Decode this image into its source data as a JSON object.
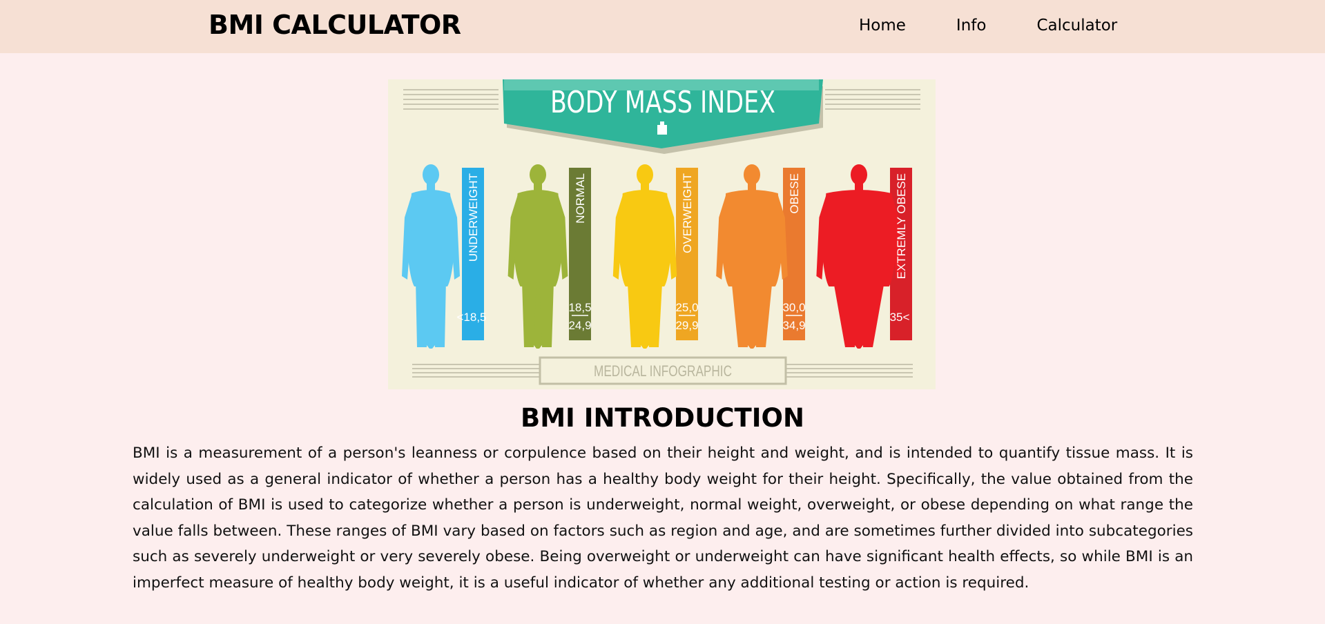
{
  "header": {
    "brand": "BMI CALCULATOR",
    "nav": [
      "Home",
      "Info",
      "Calculator"
    ]
  },
  "infographic": {
    "title": "BODY MASS INDEX",
    "footer": "MEDICAL INFOGRAPHIC",
    "categories": [
      {
        "label": "UNDERWEIGHT",
        "range_top": "<18,5",
        "range_bottom": "",
        "bar_color": "#2aaee6",
        "figure_color": "#5cc9f2"
      },
      {
        "label": "NORMAL",
        "range_top": "18,5",
        "range_bottom": "24,9",
        "bar_color": "#6b7b34",
        "figure_color": "#9db43a"
      },
      {
        "label": "OVERWEIGHT",
        "range_top": "25,0",
        "range_bottom": "29,9",
        "bar_color": "#efa622",
        "figure_color": "#f8c912"
      },
      {
        "label": "OBESE",
        "range_top": "30,0",
        "range_bottom": "34,9",
        "bar_color": "#ea7a2f",
        "figure_color": "#f28a30"
      },
      {
        "label": "EXTREMLY OBESE",
        "range_top": "35<",
        "range_bottom": "",
        "bar_color": "#d82129",
        "figure_color": "#ec1c24"
      }
    ]
  },
  "intro": {
    "title": "BMI INTRODUCTION",
    "text": "BMI is a measurement of a person's leanness or corpulence based on their height and weight, and is intended to quantify tissue mass. It is widely used as a general indicator of whether a person has a healthy body weight for their height. Specifically, the value obtained from the calculation of BMI is used to categorize whether a person is underweight, normal weight, overweight, or obese depending on what range the value falls between. These ranges of BMI vary based on factors such as region and age, and are sometimes further divided into subcategories such as severely underweight or very severely obese. Being overweight or underweight can have significant health effects, so while BMI is an imperfect measure of healthy body weight, it is a useful indicator of whether any additional testing or action is required."
  }
}
